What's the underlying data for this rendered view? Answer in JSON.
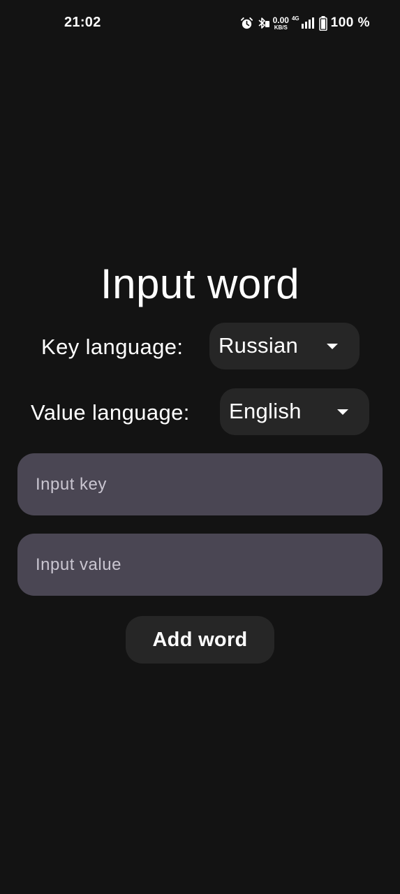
{
  "status_bar": {
    "time": "21:02",
    "net_speed_value": "0.00",
    "net_speed_unit": "KB/S",
    "network_type": "4G",
    "battery_percent": "100 %",
    "icons": [
      "alarm-icon",
      "bluetooth-icon",
      "signal-icon",
      "battery-icon"
    ]
  },
  "page": {
    "title": "Input word"
  },
  "key_language": {
    "label": "Key language:",
    "selected": "Russian"
  },
  "value_language": {
    "label": "Value language:",
    "selected": "English"
  },
  "fields": {
    "key_placeholder": "Input key",
    "key_value": "",
    "value_placeholder": "Input value",
    "value_value": ""
  },
  "actions": {
    "add_word_label": "Add word"
  },
  "colors": {
    "background": "#131313",
    "surface": "#262626",
    "field_fill": "#4a4653",
    "text": "#ffffff",
    "placeholder": "#c9c5d0"
  }
}
